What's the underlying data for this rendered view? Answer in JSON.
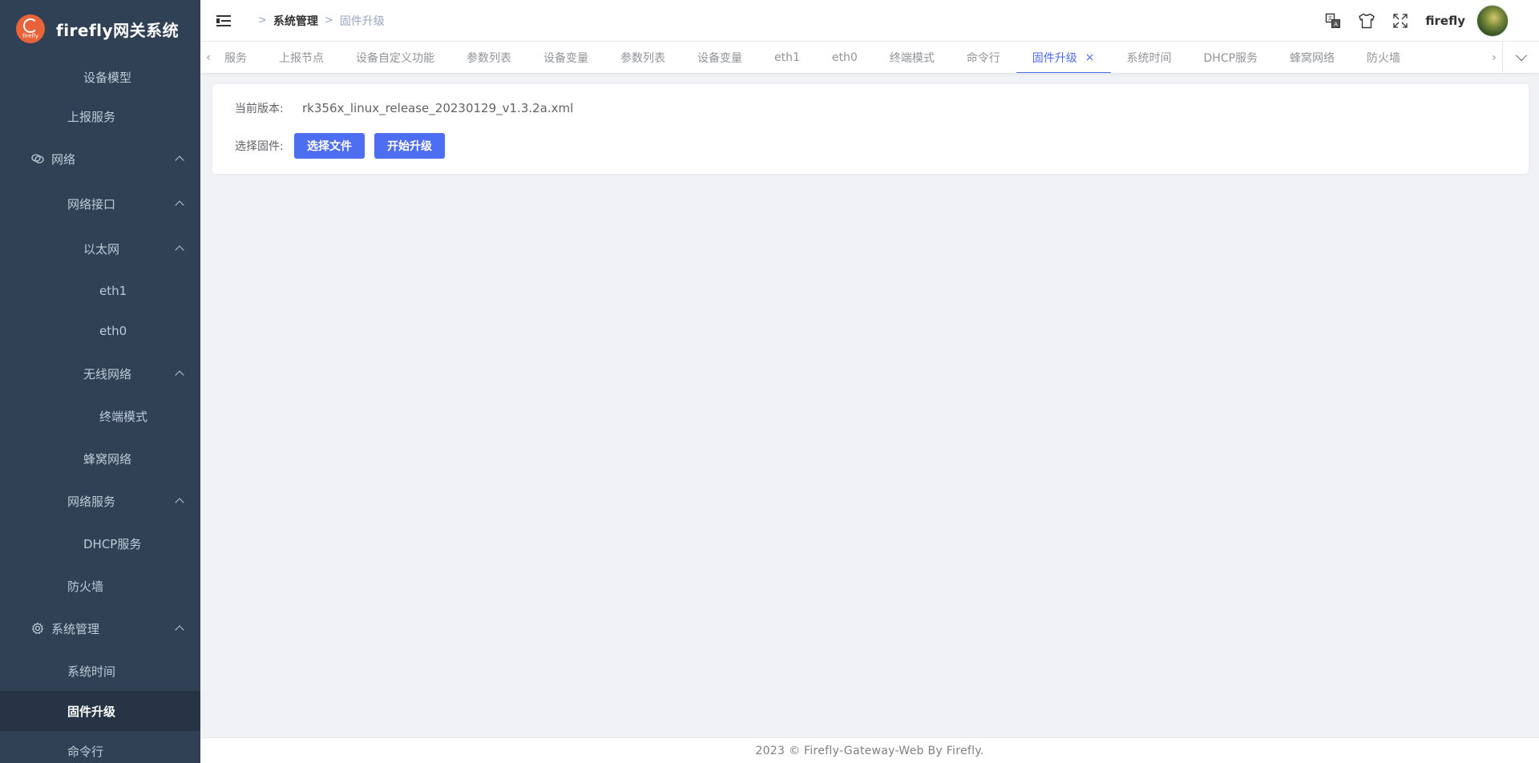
{
  "brand": {
    "title": "firefly网关系统",
    "logo_text": "firefly"
  },
  "sidebar": {
    "items": [
      {
        "label": "设备模型"
      },
      {
        "label": "上报服务"
      },
      {
        "label": "网络"
      },
      {
        "label": "网络接口"
      },
      {
        "label": "以太网"
      },
      {
        "label": "eth1"
      },
      {
        "label": "eth0"
      },
      {
        "label": "无线网络"
      },
      {
        "label": "终端模式"
      },
      {
        "label": "蜂窝网络"
      },
      {
        "label": "网络服务"
      },
      {
        "label": "DHCP服务"
      },
      {
        "label": "防火墙"
      },
      {
        "label": "系统管理"
      },
      {
        "label": "系统时间"
      },
      {
        "label": "固件升级"
      },
      {
        "label": "命令行"
      }
    ]
  },
  "header": {
    "breadcrumb": [
      "系统管理",
      "固件升级"
    ],
    "username": "firefly",
    "icons": [
      "translate-icon",
      "theme-icon",
      "fullscreen-icon"
    ]
  },
  "tags": {
    "items": [
      "服务",
      "上报节点",
      "设备自定义功能",
      "参数列表",
      "设备变量",
      "参数列表",
      "设备变量",
      "eth1",
      "eth0",
      "终端模式",
      "命令行",
      "固件升级",
      "系统时间",
      "DHCP服务",
      "蜂窝网络",
      "防火墙"
    ],
    "active": "固件升级",
    "close_glyph": "×"
  },
  "firmware": {
    "current_label": "当前版本:",
    "current_value": "rk356x_linux_release_20230129_v1.3.2a.xml",
    "select_label": "选择固件:",
    "choose_button": "选择文件",
    "upgrade_button": "开始升级"
  },
  "footer": {
    "text": "2023 © Firefly-Gateway-Web By Firefly."
  },
  "colors": {
    "sidebar_bg": "#304156",
    "accent": "#4e6ef2",
    "brand_logo": "#e8623a"
  }
}
